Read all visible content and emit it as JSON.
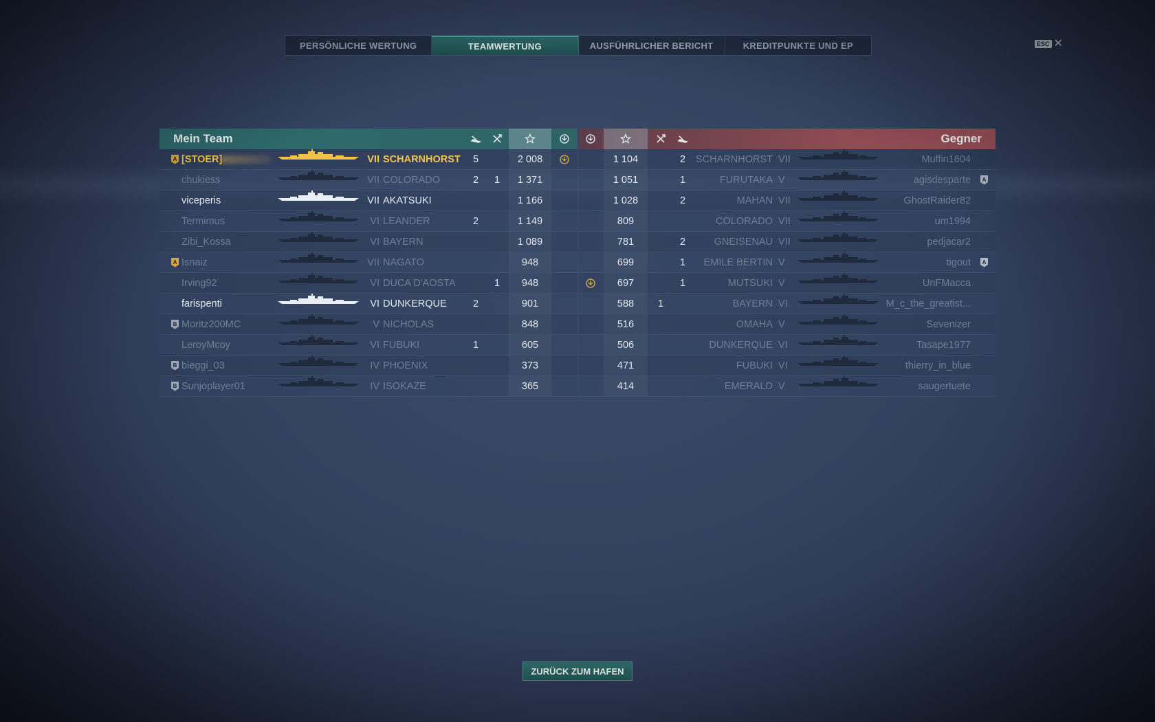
{
  "tabs": [
    {
      "label": "PERSÖNLICHE WERTUNG",
      "active": false
    },
    {
      "label": "TEAMWERTUNG",
      "active": true
    },
    {
      "label": "AUSFÜHRLICHER BERICHT",
      "active": false
    },
    {
      "label": "KREDITPUNKTE UND EP",
      "active": false
    }
  ],
  "esc": {
    "key": "ESC",
    "close": "✕"
  },
  "my_team": {
    "title": "Mein Team",
    "players": [
      {
        "badge": "A",
        "name": "[STOER]",
        "ship_style": "gold",
        "tier": "VII",
        "ship": "SCHARNHORST",
        "kills": "5",
        "planes": "",
        "xp": "2 008",
        "medal": true,
        "style": "gold"
      },
      {
        "badge": "",
        "name": "chukiess",
        "ship_style": "dark",
        "tier": "VII",
        "ship": "COLORADO",
        "kills": "2",
        "planes": "1",
        "xp": "1 371",
        "medal": false,
        "style": "dim"
      },
      {
        "badge": "",
        "name": "viceperis",
        "ship_style": "white",
        "tier": "VII",
        "ship": "AKATSUKI",
        "kills": "",
        "planes": "",
        "xp": "1 166",
        "medal": false,
        "style": "bright"
      },
      {
        "badge": "",
        "name": "Termimus",
        "ship_style": "dark",
        "tier": "VI",
        "ship": "LEANDER",
        "kills": "2",
        "planes": "",
        "xp": "1 149",
        "medal": false,
        "style": "dim"
      },
      {
        "badge": "",
        "name": "Zibi_Kossa",
        "ship_style": "dark",
        "tier": "VI",
        "ship": "BAYERN",
        "kills": "",
        "planes": "",
        "xp": "1 089",
        "medal": false,
        "style": "dim"
      },
      {
        "badge": "A",
        "name": "Isnaiz",
        "ship_style": "dark",
        "tier": "VII",
        "ship": "NAGATO",
        "kills": "",
        "planes": "",
        "xp": "948",
        "medal": false,
        "style": "dim"
      },
      {
        "badge": "",
        "name": "Irving92",
        "ship_style": "dark",
        "tier": "VI",
        "ship": "DUCA D'AOSTA",
        "kills": "",
        "planes": "1",
        "xp": "948",
        "medal": false,
        "style": "dim"
      },
      {
        "badge": "",
        "name": "farispenti",
        "ship_style": "white",
        "tier": "VI",
        "ship": "DUNKERQUE",
        "kills": "2",
        "planes": "",
        "xp": "901",
        "medal": false,
        "style": "bright"
      },
      {
        "badge": "B",
        "name": "Moritz200MC",
        "ship_style": "dark",
        "tier": "V",
        "ship": "NICHOLAS",
        "kills": "",
        "planes": "",
        "xp": "848",
        "medal": false,
        "style": "dim"
      },
      {
        "badge": "",
        "name": "LeroyMcoy",
        "ship_style": "dark",
        "tier": "VI",
        "ship": "FUBUKI",
        "kills": "1",
        "planes": "",
        "xp": "605",
        "medal": false,
        "style": "dim"
      },
      {
        "badge": "B",
        "name": "bieggi_03",
        "ship_style": "dark",
        "tier": "IV",
        "ship": "PHOENIX",
        "kills": "",
        "planes": "",
        "xp": "373",
        "medal": false,
        "style": "dim"
      },
      {
        "badge": "B",
        "name": "Sunjoplayer01",
        "ship_style": "dark",
        "tier": "IV",
        "ship": "ISOKAZE",
        "kills": "",
        "planes": "",
        "xp": "365",
        "medal": false,
        "style": "dim"
      }
    ]
  },
  "enemy_team": {
    "title": "Gegner",
    "players": [
      {
        "medal": false,
        "xp": "1 104",
        "planes": "",
        "kills": "2",
        "ship": "SCHARNHORST",
        "tier": "VII",
        "name": "Muffin1604",
        "badge": ""
      },
      {
        "medal": false,
        "xp": "1 051",
        "planes": "",
        "kills": "1",
        "ship": "FURUTAKA",
        "tier": "V",
        "name": "agisdesparte",
        "badge": "A"
      },
      {
        "medal": false,
        "xp": "1 028",
        "planes": "",
        "kills": "2",
        "ship": "MAHAN",
        "tier": "VII",
        "name": "GhostRaider82",
        "badge": ""
      },
      {
        "medal": false,
        "xp": "809",
        "planes": "",
        "kills": "",
        "ship": "COLORADO",
        "tier": "VII",
        "name": "um1994",
        "badge": ""
      },
      {
        "medal": false,
        "xp": "781",
        "planes": "",
        "kills": "2",
        "ship": "GNEISENAU",
        "tier": "VII",
        "name": "pedjacar2",
        "badge": ""
      },
      {
        "medal": false,
        "xp": "699",
        "planes": "",
        "kills": "1",
        "ship": "EMILE BERTIN",
        "tier": "V",
        "name": "tigout",
        "badge": "A"
      },
      {
        "medal": true,
        "xp": "697",
        "planes": "",
        "kills": "1",
        "ship": "MUTSUKI",
        "tier": "V",
        "name": "UnFMacca",
        "badge": ""
      },
      {
        "medal": false,
        "xp": "588",
        "planes": "1",
        "kills": "",
        "ship": "BAYERN",
        "tier": "VI",
        "name": "M_c_the_greatist...",
        "badge": ""
      },
      {
        "medal": false,
        "xp": "516",
        "planes": "",
        "kills": "",
        "ship": "OMAHA",
        "tier": "V",
        "name": "Sevenizer",
        "badge": ""
      },
      {
        "medal": false,
        "xp": "506",
        "planes": "",
        "kills": "",
        "ship": "DUNKERQUE",
        "tier": "VI",
        "name": "Tasape1977",
        "badge": ""
      },
      {
        "medal": false,
        "xp": "471",
        "planes": "",
        "kills": "",
        "ship": "FUBUKI",
        "tier": "VI",
        "name": "thierry_in_blue",
        "badge": ""
      },
      {
        "medal": false,
        "xp": "414",
        "planes": "",
        "kills": "",
        "ship": "EMERALD",
        "tier": "V",
        "name": "saugertuete",
        "badge": ""
      }
    ]
  },
  "back_button": "ZURÜCK ZUM HAFEN",
  "colors": {
    "accent_teal": "#2e6b6e",
    "enemy_red": "#9a5058",
    "gold": "#f3c44e"
  }
}
